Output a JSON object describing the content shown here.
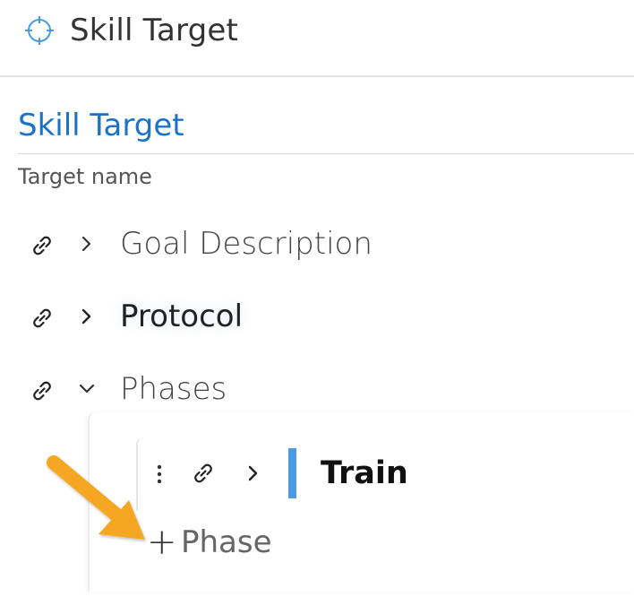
{
  "header": {
    "icon": "crosshair-icon",
    "title": "Skill Target"
  },
  "section": {
    "title": "Skill Target",
    "field_label": "Target name"
  },
  "rows": [
    {
      "label": "Goal Description",
      "expanded": false,
      "icons": [
        "link-icon",
        "chevron-right-icon"
      ]
    },
    {
      "label": "Protocol",
      "expanded": false,
      "icons": [
        "link-icon",
        "chevron-right-icon"
      ]
    },
    {
      "label": "Phases",
      "expanded": true,
      "icons": [
        "link-icon",
        "chevron-down-icon"
      ]
    }
  ],
  "phases": {
    "items": [
      {
        "name": "Train",
        "color": "#4a9be0",
        "icons": [
          "kebab-menu-icon",
          "link-icon",
          "chevron-right-icon"
        ]
      }
    ],
    "add_plus": "+",
    "add_label": "Phase"
  },
  "colors": {
    "accent": "#1a73c7",
    "icon_blue": "#4a9be0",
    "annotation_arrow": "#f5a623"
  }
}
